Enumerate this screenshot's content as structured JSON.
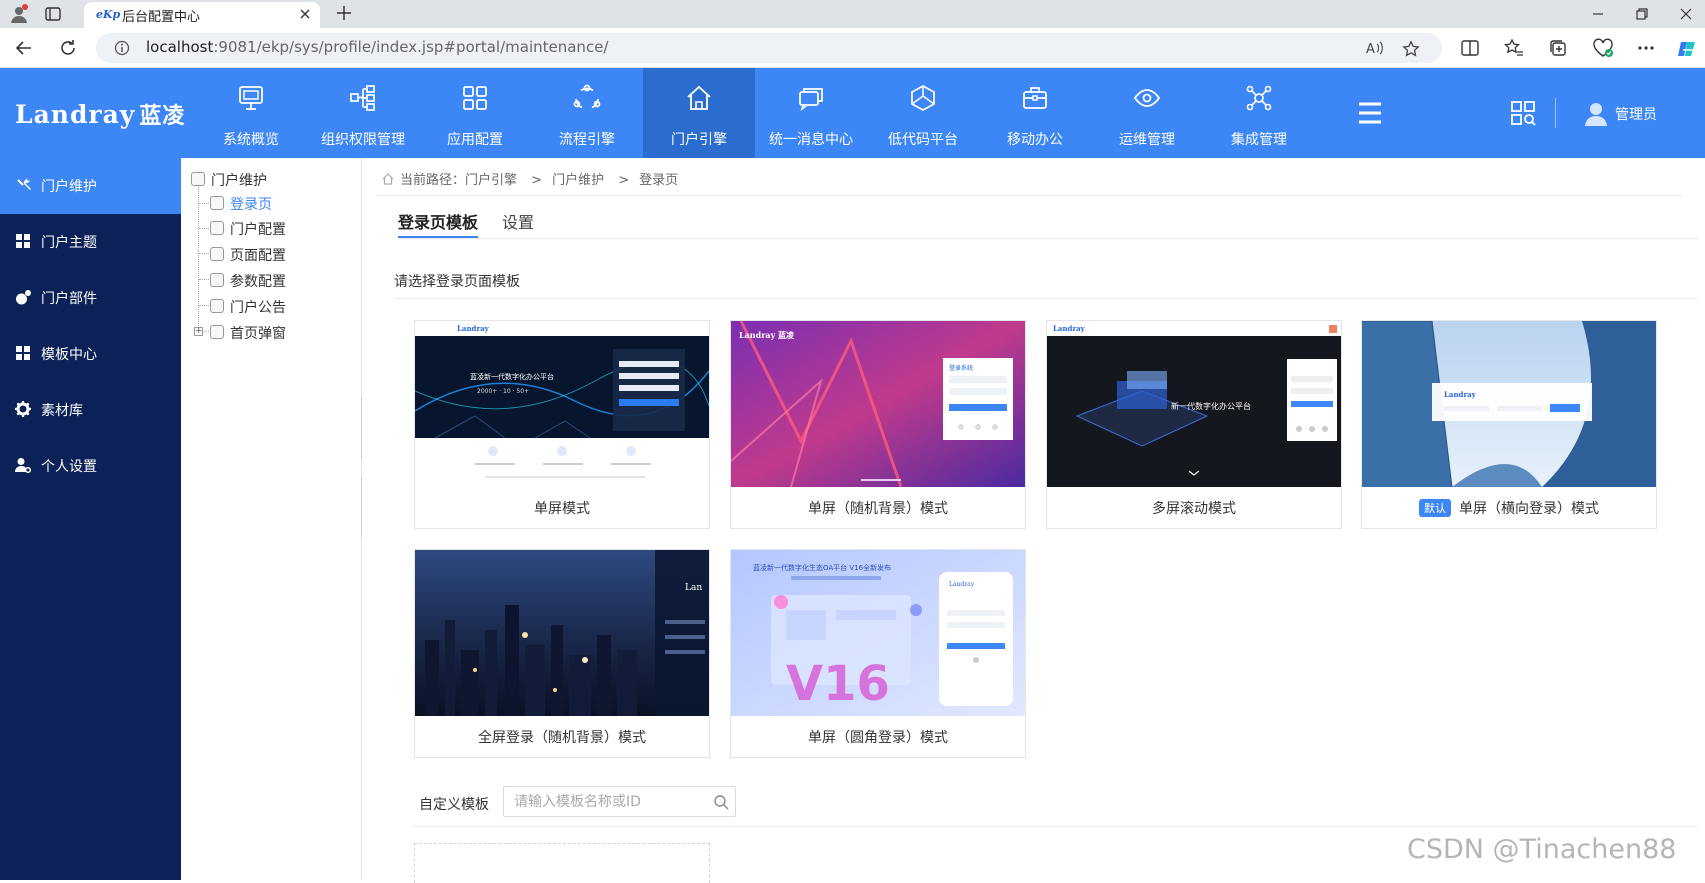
{
  "browser": {
    "tab_title": "后台配置中心",
    "tab_favicon": "eKp",
    "url_host": "localhost",
    "url_rest": ":9081/ekp/sys/profile/index.jsp#portal/maintenance/"
  },
  "header": {
    "logo_en": "Landray",
    "logo_cn": "蓝凌",
    "nav": [
      {
        "label": "系统概览",
        "icon": "monitor-icon"
      },
      {
        "label": "组织权限管理",
        "icon": "org-chart-icon"
      },
      {
        "label": "应用配置",
        "icon": "grid-icon"
      },
      {
        "label": "流程引擎",
        "icon": "flow-cycle-icon"
      },
      {
        "label": "门户引擎",
        "icon": "home-icon"
      },
      {
        "label": "统一消息中心",
        "icon": "message-icon"
      },
      {
        "label": "低代码平台",
        "icon": "cube-icon"
      },
      {
        "label": "移动办公",
        "icon": "briefcase-icon"
      },
      {
        "label": "运维管理",
        "icon": "eye-icon"
      },
      {
        "label": "集成管理",
        "icon": "network-icon"
      }
    ],
    "user_name": "管理员"
  },
  "sidebar": {
    "items": [
      {
        "label": "门户维护",
        "icon": "tools-icon"
      },
      {
        "label": "门户主题",
        "icon": "tiles-icon"
      },
      {
        "label": "门户部件",
        "icon": "widget-icon"
      },
      {
        "label": "模板中心",
        "icon": "template-icon"
      },
      {
        "label": "素材库",
        "icon": "gear-icon"
      },
      {
        "label": "个人设置",
        "icon": "user-gear-icon"
      }
    ]
  },
  "tree": {
    "root": "门户维护",
    "children": [
      "登录页",
      "门户配置",
      "页面配置",
      "参数配置",
      "门户公告",
      "首页弹窗"
    ]
  },
  "main": {
    "breadcrumb_prefix": "当前路径：",
    "breadcrumb": [
      "门户引擎",
      "门户维护",
      "登录页"
    ],
    "breadcrumb_sep": ">",
    "tabs": [
      "登录页模板",
      "设置"
    ],
    "section_title": "请选择登录页面模板",
    "templates": [
      {
        "label": "单屏模式"
      },
      {
        "label": "单屏（随机背景）模式"
      },
      {
        "label": "多屏滚动模式"
      },
      {
        "label": "单屏（横向登录）模式",
        "badge": "默认"
      },
      {
        "label": "全屏登录（随机背景）模式"
      },
      {
        "label": "单屏（圆角登录）模式"
      }
    ],
    "thumb_text": {
      "t1_headline": "蓝凌新一代数字化办公平台",
      "t3_headline": "新一代数字化办公平台",
      "t6_headline": "蓝凌新一代数字化生态OA平台 V16全新发布",
      "t6_big": "V16",
      "t2_login": "登录系统"
    },
    "custom_label": "自定义模板",
    "search_placeholder": "请输入模板名称或ID"
  },
  "watermark": "CSDN @Tinachen88"
}
